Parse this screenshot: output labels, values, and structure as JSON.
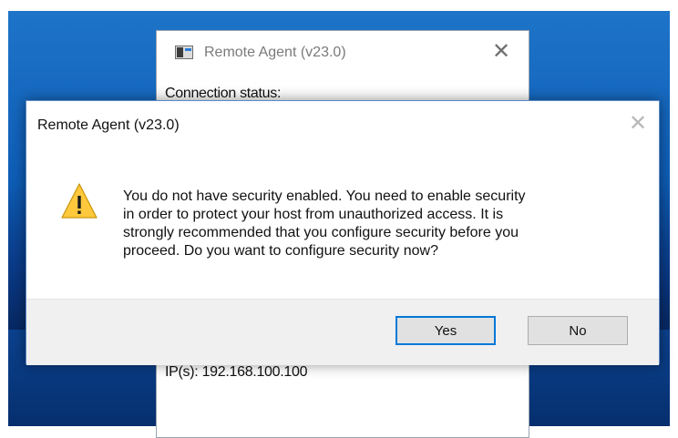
{
  "back_window": {
    "title": "Remote Agent (v23.0)",
    "close_glyph": "✕",
    "status_label": "Connection status:",
    "ip_text": "IP(s): 192.168.100.100"
  },
  "dialog": {
    "title": "Remote Agent (v23.0)",
    "close_glyph": "✕",
    "icon": "warning-icon",
    "message_lines": [
      "You do not have security enabled. You need to enable security",
      "in order to protect your host from unauthorized access. It is",
      "strongly recommended that you configure security before you",
      "proceed. Do you want to configure security now?"
    ],
    "buttons": {
      "yes_label": "Yes",
      "no_label": "No"
    }
  },
  "colors": {
    "accent": "#0078d7",
    "warning_fill": "#ffc83d",
    "desktop": "#0f5fb8"
  }
}
